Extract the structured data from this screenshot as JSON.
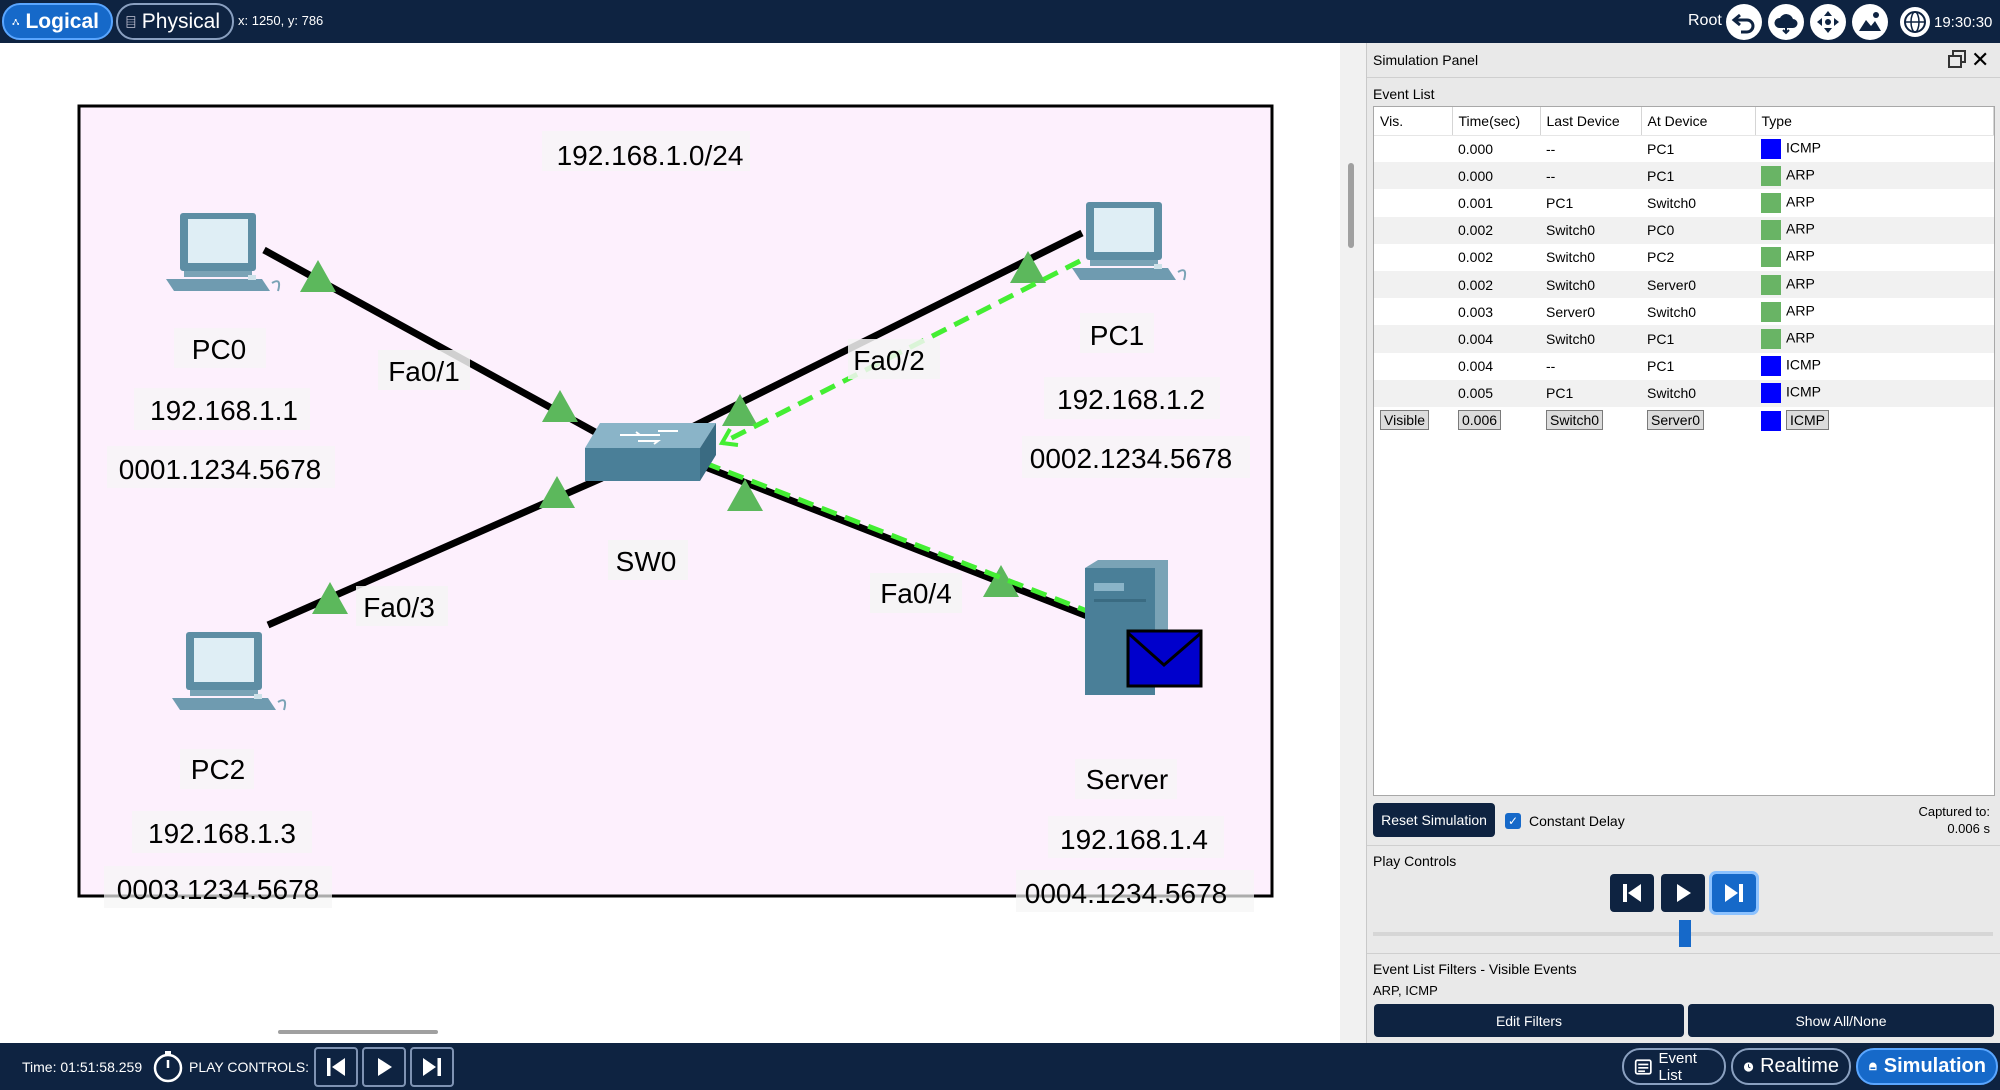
{
  "topbar": {
    "logical_label": "Logical",
    "physical_label": "Physical",
    "coords": "x: 1250, y: 786",
    "root_label": "Root",
    "clock": "19:30:30"
  },
  "network": {
    "subnet": "192.168.1.0/24",
    "switch_name": "SW0",
    "devices": {
      "pc0": {
        "name": "PC0",
        "ip": "192.168.1.1",
        "mac": "0001.1234.5678"
      },
      "pc1": {
        "name": "PC1",
        "ip": "192.168.1.2",
        "mac": "0002.1234.5678"
      },
      "pc2": {
        "name": "PC2",
        "ip": "192.168.1.3",
        "mac": "0003.1234.5678"
      },
      "server": {
        "name": "Server",
        "ip": "192.168.1.4",
        "mac": "0004.1234.5678"
      }
    },
    "ports": {
      "fa01": "Fa0/1",
      "fa02": "Fa0/2",
      "fa03": "Fa0/3",
      "fa04": "Fa0/4"
    },
    "colors": {
      "area": "#fdf0fd",
      "link": "#000000",
      "link_up": "#5cb85c",
      "pdu_path": "#44ee33",
      "pdu": "#0000cc"
    }
  },
  "sim_panel": {
    "title": "Simulation Panel",
    "event_list_title": "Event List",
    "columns": [
      "Vis.",
      "Time(sec)",
      "Last Device",
      "At Device",
      "Type"
    ],
    "events": [
      {
        "vis": "",
        "time": "0.000",
        "last": "--",
        "at": "PC1",
        "type": "ICMP",
        "color": "#0000ff"
      },
      {
        "vis": "",
        "time": "0.000",
        "last": "--",
        "at": "PC1",
        "type": "ARP",
        "color": "#69b465"
      },
      {
        "vis": "",
        "time": "0.001",
        "last": "PC1",
        "at": "Switch0",
        "type": "ARP",
        "color": "#69b465"
      },
      {
        "vis": "",
        "time": "0.002",
        "last": "Switch0",
        "at": "PC0",
        "type": "ARP",
        "color": "#69b465"
      },
      {
        "vis": "",
        "time": "0.002",
        "last": "Switch0",
        "at": "PC2",
        "type": "ARP",
        "color": "#69b465"
      },
      {
        "vis": "",
        "time": "0.002",
        "last": "Switch0",
        "at": "Server0",
        "type": "ARP",
        "color": "#69b465"
      },
      {
        "vis": "",
        "time": "0.003",
        "last": "Server0",
        "at": "Switch0",
        "type": "ARP",
        "color": "#69b465"
      },
      {
        "vis": "",
        "time": "0.004",
        "last": "Switch0",
        "at": "PC1",
        "type": "ARP",
        "color": "#69b465"
      },
      {
        "vis": "",
        "time": "0.004",
        "last": "--",
        "at": "PC1",
        "type": "ICMP",
        "color": "#0000ff"
      },
      {
        "vis": "",
        "time": "0.005",
        "last": "PC1",
        "at": "Switch0",
        "type": "ICMP",
        "color": "#0000ff"
      },
      {
        "vis": "Visible",
        "time": "0.006",
        "last": "Switch0",
        "at": "Server0",
        "type": "ICMP",
        "color": "#0000ff"
      }
    ],
    "reset_label": "Reset Simulation",
    "constant_delay_label": "Constant Delay",
    "constant_delay_checked": true,
    "captured_label": "Captured to:",
    "captured_value": "0.006 s",
    "play_controls_title": "Play Controls",
    "filters_title": "Event List Filters - Visible Events",
    "filters_value": "ARP, ICMP",
    "edit_filters_label": "Edit Filters",
    "show_all_label": "Show All/None"
  },
  "bottombar": {
    "time_label": "Time: 01:51:58.259",
    "play_controls_label": "PLAY CONTROLS:",
    "event_list_label": "Event List",
    "realtime_label": "Realtime",
    "simulation_label": "Simulation"
  }
}
